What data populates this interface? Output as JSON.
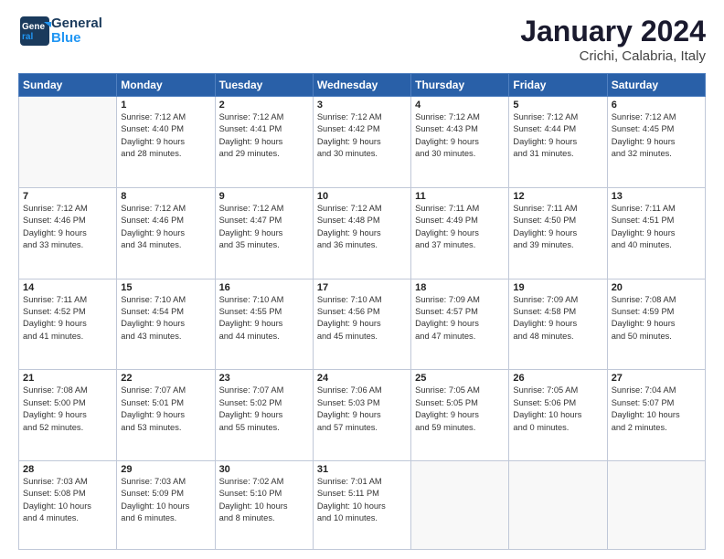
{
  "header": {
    "logo_line1": "General",
    "logo_line2": "Blue",
    "month": "January 2024",
    "location": "Crichi, Calabria, Italy"
  },
  "weekdays": [
    "Sunday",
    "Monday",
    "Tuesday",
    "Wednesday",
    "Thursday",
    "Friday",
    "Saturday"
  ],
  "weeks": [
    [
      {
        "day": "",
        "info": ""
      },
      {
        "day": "1",
        "info": "Sunrise: 7:12 AM\nSunset: 4:40 PM\nDaylight: 9 hours\nand 28 minutes."
      },
      {
        "day": "2",
        "info": "Sunrise: 7:12 AM\nSunset: 4:41 PM\nDaylight: 9 hours\nand 29 minutes."
      },
      {
        "day": "3",
        "info": "Sunrise: 7:12 AM\nSunset: 4:42 PM\nDaylight: 9 hours\nand 30 minutes."
      },
      {
        "day": "4",
        "info": "Sunrise: 7:12 AM\nSunset: 4:43 PM\nDaylight: 9 hours\nand 30 minutes."
      },
      {
        "day": "5",
        "info": "Sunrise: 7:12 AM\nSunset: 4:44 PM\nDaylight: 9 hours\nand 31 minutes."
      },
      {
        "day": "6",
        "info": "Sunrise: 7:12 AM\nSunset: 4:45 PM\nDaylight: 9 hours\nand 32 minutes."
      }
    ],
    [
      {
        "day": "7",
        "info": "Sunrise: 7:12 AM\nSunset: 4:46 PM\nDaylight: 9 hours\nand 33 minutes."
      },
      {
        "day": "8",
        "info": "Sunrise: 7:12 AM\nSunset: 4:46 PM\nDaylight: 9 hours\nand 34 minutes."
      },
      {
        "day": "9",
        "info": "Sunrise: 7:12 AM\nSunset: 4:47 PM\nDaylight: 9 hours\nand 35 minutes."
      },
      {
        "day": "10",
        "info": "Sunrise: 7:12 AM\nSunset: 4:48 PM\nDaylight: 9 hours\nand 36 minutes."
      },
      {
        "day": "11",
        "info": "Sunrise: 7:11 AM\nSunset: 4:49 PM\nDaylight: 9 hours\nand 37 minutes."
      },
      {
        "day": "12",
        "info": "Sunrise: 7:11 AM\nSunset: 4:50 PM\nDaylight: 9 hours\nand 39 minutes."
      },
      {
        "day": "13",
        "info": "Sunrise: 7:11 AM\nSunset: 4:51 PM\nDaylight: 9 hours\nand 40 minutes."
      }
    ],
    [
      {
        "day": "14",
        "info": "Sunrise: 7:11 AM\nSunset: 4:52 PM\nDaylight: 9 hours\nand 41 minutes."
      },
      {
        "day": "15",
        "info": "Sunrise: 7:10 AM\nSunset: 4:54 PM\nDaylight: 9 hours\nand 43 minutes."
      },
      {
        "day": "16",
        "info": "Sunrise: 7:10 AM\nSunset: 4:55 PM\nDaylight: 9 hours\nand 44 minutes."
      },
      {
        "day": "17",
        "info": "Sunrise: 7:10 AM\nSunset: 4:56 PM\nDaylight: 9 hours\nand 45 minutes."
      },
      {
        "day": "18",
        "info": "Sunrise: 7:09 AM\nSunset: 4:57 PM\nDaylight: 9 hours\nand 47 minutes."
      },
      {
        "day": "19",
        "info": "Sunrise: 7:09 AM\nSunset: 4:58 PM\nDaylight: 9 hours\nand 48 minutes."
      },
      {
        "day": "20",
        "info": "Sunrise: 7:08 AM\nSunset: 4:59 PM\nDaylight: 9 hours\nand 50 minutes."
      }
    ],
    [
      {
        "day": "21",
        "info": "Sunrise: 7:08 AM\nSunset: 5:00 PM\nDaylight: 9 hours\nand 52 minutes."
      },
      {
        "day": "22",
        "info": "Sunrise: 7:07 AM\nSunset: 5:01 PM\nDaylight: 9 hours\nand 53 minutes."
      },
      {
        "day": "23",
        "info": "Sunrise: 7:07 AM\nSunset: 5:02 PM\nDaylight: 9 hours\nand 55 minutes."
      },
      {
        "day": "24",
        "info": "Sunrise: 7:06 AM\nSunset: 5:03 PM\nDaylight: 9 hours\nand 57 minutes."
      },
      {
        "day": "25",
        "info": "Sunrise: 7:05 AM\nSunset: 5:05 PM\nDaylight: 9 hours\nand 59 minutes."
      },
      {
        "day": "26",
        "info": "Sunrise: 7:05 AM\nSunset: 5:06 PM\nDaylight: 10 hours\nand 0 minutes."
      },
      {
        "day": "27",
        "info": "Sunrise: 7:04 AM\nSunset: 5:07 PM\nDaylight: 10 hours\nand 2 minutes."
      }
    ],
    [
      {
        "day": "28",
        "info": "Sunrise: 7:03 AM\nSunset: 5:08 PM\nDaylight: 10 hours\nand 4 minutes."
      },
      {
        "day": "29",
        "info": "Sunrise: 7:03 AM\nSunset: 5:09 PM\nDaylight: 10 hours\nand 6 minutes."
      },
      {
        "day": "30",
        "info": "Sunrise: 7:02 AM\nSunset: 5:10 PM\nDaylight: 10 hours\nand 8 minutes."
      },
      {
        "day": "31",
        "info": "Sunrise: 7:01 AM\nSunset: 5:11 PM\nDaylight: 10 hours\nand 10 minutes."
      },
      {
        "day": "",
        "info": ""
      },
      {
        "day": "",
        "info": ""
      },
      {
        "day": "",
        "info": ""
      }
    ]
  ]
}
